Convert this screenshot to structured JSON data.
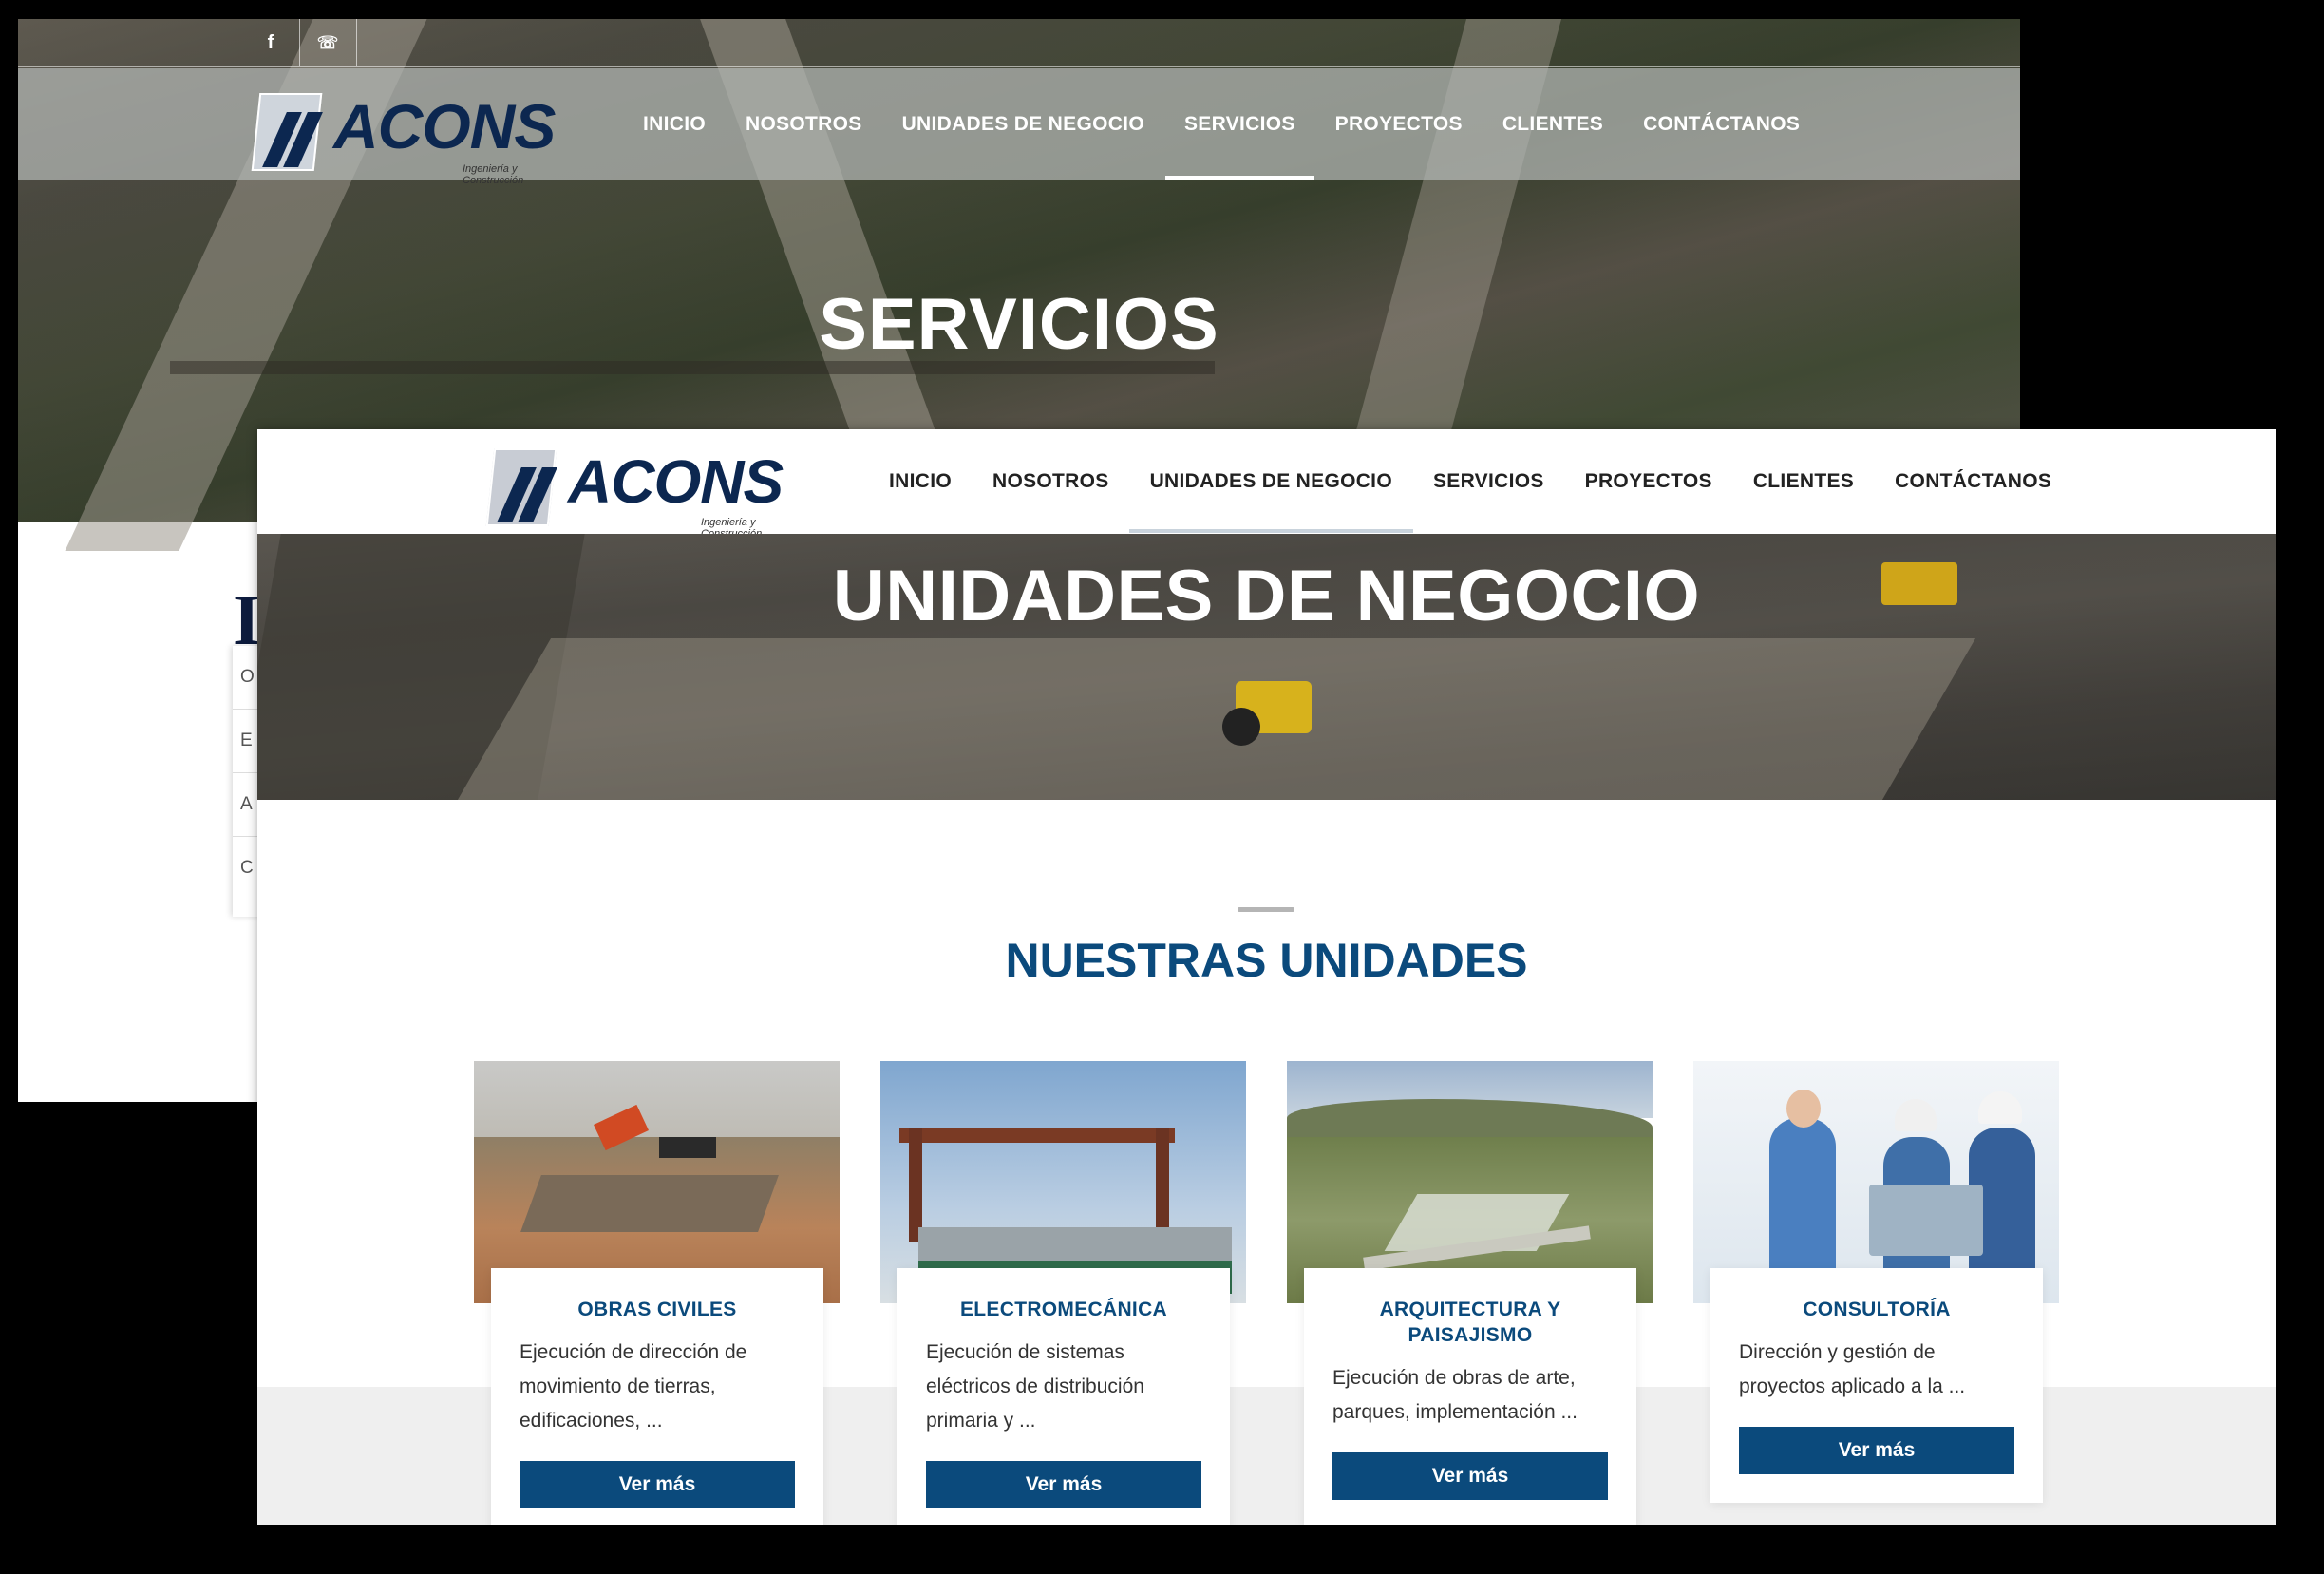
{
  "back_page": {
    "social": [
      "f",
      "☏"
    ],
    "logo": {
      "word": "ACONS",
      "tagline": "Ingeniería y Construcción"
    },
    "nav": [
      "INICIO",
      "NOSOTROS",
      "UNIDADES DE NEGOCIO",
      "SERVICIOS",
      "PROYECTOS",
      "CLIENTES",
      "CONTÁCTANOS"
    ],
    "active_nav": "SERVICIOS",
    "hero_title": "SERVICIOS",
    "side_heading": "I",
    "side_items": [
      "O",
      "E",
      "A",
      "C"
    ]
  },
  "front_page": {
    "logo": {
      "word": "ACONS",
      "tagline": "Ingeniería y Construcción"
    },
    "nav": [
      "INICIO",
      "NOSOTROS",
      "UNIDADES DE NEGOCIO",
      "SERVICIOS",
      "PROYECTOS",
      "CLIENTES",
      "CONTÁCTANOS"
    ],
    "active_nav": "UNIDADES DE NEGOCIO",
    "hero_title": "UNIDADES DE NEGOCIO",
    "section_title": "NUESTRAS UNIDADES",
    "units": [
      {
        "title": "OBRAS CIVILES",
        "desc": "Ejecución de dirección de movimiento de tierras, edificaciones, ...",
        "button": "Ver más"
      },
      {
        "title": "ELECTROMECÁNICA",
        "desc": "Ejecución de sistemas eléctricos de distribución primaria y ...",
        "button": "Ver más"
      },
      {
        "title": "ARQUITECTURA Y PAISAJISMO",
        "desc": " Ejecución de obras de arte, parques, implementación ...",
        "button": "Ver más"
      },
      {
        "title": "CONSULTORÍA",
        "desc": "Dirección y gestión de proyectos aplicado a la ...",
        "button": "Ver más"
      }
    ]
  },
  "colors": {
    "brand_blue": "#0b4a7c",
    "logo_navy": "#0c2750",
    "band_gray": "#efefef"
  }
}
